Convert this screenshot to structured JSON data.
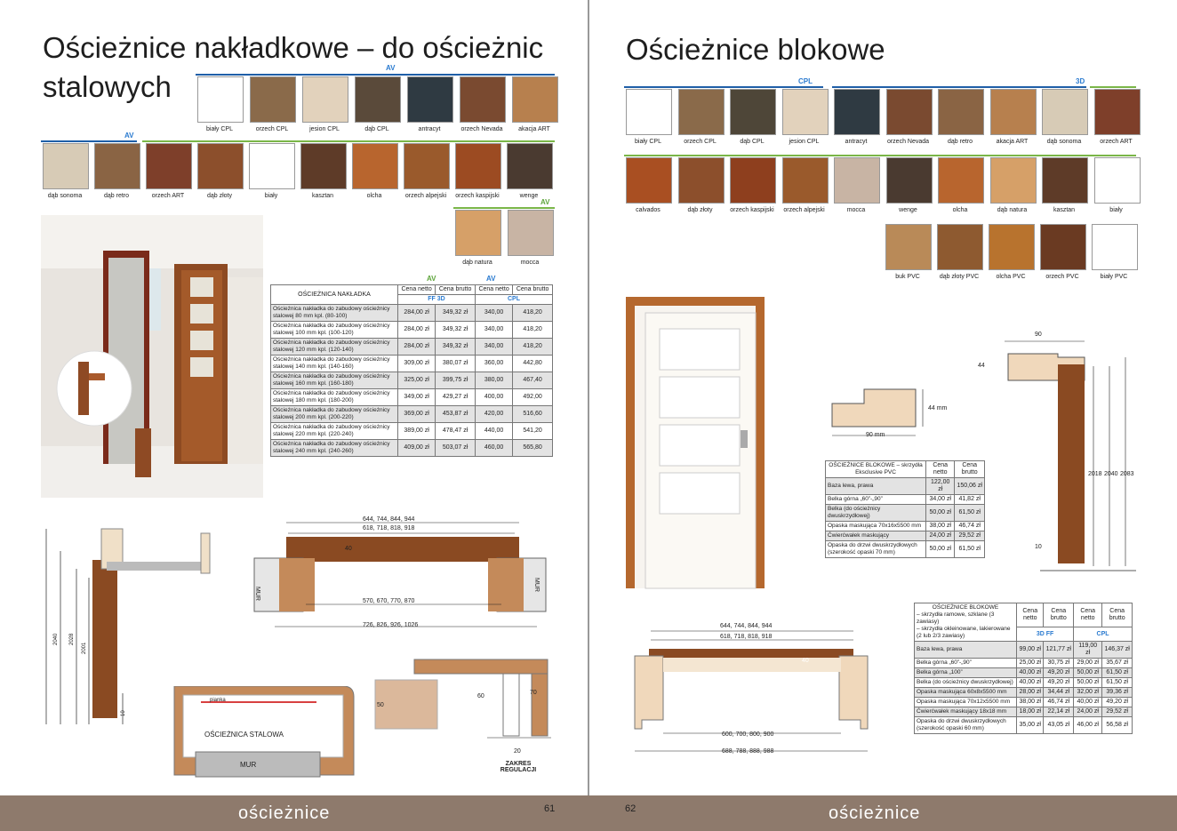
{
  "left": {
    "title_line1": "Ościeżnice nakładkowe – do ościeżnic",
    "title_line2": "stalowych",
    "swatches_row1": [
      {
        "label": "biały CPL",
        "color": "#ffffff"
      },
      {
        "label": "orzech CPL",
        "color": "#8a6a4a"
      },
      {
        "label": "jesion CPL",
        "color": "#e2d2bc"
      },
      {
        "label": "dąb CPL",
        "color": "#5a4a3a"
      },
      {
        "label": "antracyt",
        "color": "#2f3a42"
      },
      {
        "label": "orzech Nevada",
        "color": "#7a4a30"
      },
      {
        "label": "akacja ART",
        "color": "#b7804e"
      }
    ],
    "swatches_row2": [
      {
        "label": "dąb sonoma",
        "color": "#d7cbb6"
      },
      {
        "label": "dąb retro",
        "color": "#8a6444"
      },
      {
        "label": "orzech ART",
        "color": "#7e3f2a"
      },
      {
        "label": "dąb złoty",
        "color": "#8c4f2c"
      },
      {
        "label": "biały",
        "color": "#ffffff"
      },
      {
        "label": "kasztan",
        "color": "#5e3b28"
      },
      {
        "label": "olcha",
        "color": "#b8652e"
      },
      {
        "label": "orzech alpejski",
        "color": "#9a5a2c"
      },
      {
        "label": "orzech kaspijski",
        "color": "#9c4b22"
      },
      {
        "label": "wenge",
        "color": "#4a3a30"
      }
    ],
    "swatches_row3": [
      {
        "label": "dąb natura",
        "color": "#d6a068"
      },
      {
        "label": "mocca",
        "color": "#c8b4a4"
      }
    ],
    "table": {
      "header": "OŚCIEŻNICA NAKŁADKA",
      "col_netto": "Cena netto",
      "col_brutto": "Cena brutto",
      "group_a": "FF  3D",
      "group_b": "CPL",
      "rows": [
        {
          "name": "Ościeżnica nakładka do zabudowy ościeżnicy stalowej 80 mm kpl. (80-100)",
          "a_n": "284,00 zł",
          "a_b": "349,32 zł",
          "b_n": "340,00",
          "b_b": "418,20"
        },
        {
          "name": "Ościeżnica nakładka do zabudowy ościeżnicy stalowej 100 mm kpl. (100-120)",
          "a_n": "284,00 zł",
          "a_b": "349,32 zł",
          "b_n": "340,00",
          "b_b": "418,20"
        },
        {
          "name": "Ościeżnica nakładka do zabudowy ościeżnicy stalowej 120 mm kpl. (120-140)",
          "a_n": "284,00 zł",
          "a_b": "349,32 zł",
          "b_n": "340,00",
          "b_b": "418,20"
        },
        {
          "name": "Ościeżnica nakładka do zabudowy ościeżnicy stalowej 140 mm kpl. (140-160)",
          "a_n": "309,00 zł",
          "a_b": "380,07 zł",
          "b_n": "360,00",
          "b_b": "442,80"
        },
        {
          "name": "Ościeżnica nakładka do zabudowy ościeżnicy stalowej 160 mm kpl. (160-180)",
          "a_n": "325,00 zł",
          "a_b": "399,75 zł",
          "b_n": "380,00",
          "b_b": "467,40"
        },
        {
          "name": "Ościeżnica nakładka do zabudowy ościeżnicy stalowej 180 mm kpl. (180-200)",
          "a_n": "349,00 zł",
          "a_b": "429,27 zł",
          "b_n": "400,00",
          "b_b": "492,00"
        },
        {
          "name": "Ościeżnica nakładka do zabudowy ościeżnicy stalowej 200 mm kpl. (200-220)",
          "a_n": "369,00 zł",
          "a_b": "453,87 zł",
          "b_n": "420,00",
          "b_b": "516,60"
        },
        {
          "name": "Ościeżnica nakładka do zabudowy ościeżnicy stalowej 220 mm kpl. (220-240)",
          "a_n": "389,00 zł",
          "a_b": "478,47 zł",
          "b_n": "440,00",
          "b_b": "541,20"
        },
        {
          "name": "Ościeżnica nakładka do zabudowy ościeżnicy stalowej 240 mm kpl. (240-260)",
          "a_n": "409,00 zł",
          "a_b": "503,07 zł",
          "b_n": "460,00",
          "b_b": "565,80"
        }
      ]
    },
    "dims": {
      "d1": "644, 744, 844, 944",
      "d2": "618, 718, 818, 918",
      "d3": "570, 670, 770, 870",
      "d4": "726, 826, 926, 1026",
      "h1": "2079",
      "h2": "2040",
      "h3": "2028",
      "h4": "2001",
      "h5": "10",
      "v40": "40",
      "mur": "MUR",
      "osc_stal": "OŚCIEŻNICA STALOWA",
      "pianka": "pianka",
      "v50": "50",
      "v60": "60",
      "v70": "70",
      "v20": "20",
      "zakres": "ZAKRES REGULACJI"
    },
    "page_no": "61"
  },
  "right": {
    "title": "Ościeżnice blokowe",
    "swatches_row1": [
      {
        "label": "biały CPL",
        "color": "#ffffff"
      },
      {
        "label": "orzech CPL",
        "color": "#8a6a4a"
      },
      {
        "label": "dąb CPL",
        "color": "#4e4638"
      },
      {
        "label": "jesion CPL",
        "color": "#e2d2bc"
      },
      {
        "label": "antracyt",
        "color": "#2f3a42"
      },
      {
        "label": "orzech Nevada",
        "color": "#7a4a30"
      },
      {
        "label": "dąb retro",
        "color": "#8a6444"
      },
      {
        "label": "akacja ART",
        "color": "#b7804e"
      },
      {
        "label": "dąb sonoma",
        "color": "#d7cbb6"
      },
      {
        "label": "orzech ART",
        "color": "#7e3f2a"
      }
    ],
    "swatches_row2": [
      {
        "label": "calvados",
        "color": "#a94f22"
      },
      {
        "label": "dąb złoty",
        "color": "#8c4f2c"
      },
      {
        "label": "orzech kaspijski",
        "color": "#8e3f1e"
      },
      {
        "label": "orzech alpejski",
        "color": "#9a5a2c"
      },
      {
        "label": "mocca",
        "color": "#c8b4a4"
      },
      {
        "label": "wenge",
        "color": "#4a3a30"
      },
      {
        "label": "olcha",
        "color": "#b8652e"
      },
      {
        "label": "dąb natura",
        "color": "#d6a068"
      },
      {
        "label": "kasztan",
        "color": "#5e3b28"
      },
      {
        "label": "biały",
        "color": "#ffffff"
      }
    ],
    "swatches_row3": [
      {
        "label": "buk PVC",
        "color": "#b98a58"
      },
      {
        "label": "dąb złoty PVC",
        "color": "#8e5a30"
      },
      {
        "label": "olcha PVC",
        "color": "#b8732e"
      },
      {
        "label": "orzech PVC",
        "color": "#6a3a22"
      },
      {
        "label": "biały PVC",
        "color": "#ffffff"
      }
    ],
    "logo_cpl": "CPL",
    "logo_3d": "3D",
    "profile_dims": {
      "w": "90 mm",
      "h": "44 mm",
      "top": "90",
      "side": "44",
      "a": "2018",
      "b": "2040",
      "c": "2083",
      "d": "10"
    },
    "table1": {
      "header": "OŚCIEŻNICE BLOKOWE – skrzydła Eksclusive PVC",
      "col_netto": "Cena netto",
      "col_brutto": "Cena brutto",
      "rows": [
        {
          "name": "Baza lewa, prawa",
          "n": "122,00 zł",
          "b": "150,06 zł"
        },
        {
          "name": "Belka górna „60”-„90”",
          "n": "34,00 zł",
          "b": "41,82 zł"
        },
        {
          "name": "Belka (do ościeżnicy dwuskrzydłowej)",
          "n": "50,00 zł",
          "b": "61,50 zł"
        },
        {
          "name": "Opaska maskująca 70x16x5500 mm",
          "n": "38,00 zł",
          "b": "46,74 zł"
        },
        {
          "name": "Ćwierćwałek maskujący",
          "n": "24,00 zł",
          "b": "29,52 zł"
        },
        {
          "name": "Opaska do drzwi dwuskrzydłowych (szerokość opaski 70 mm)",
          "n": "50,00 zł",
          "b": "61,50 zł"
        }
      ]
    },
    "table2": {
      "header_l1": "OŚCIEŻNICE BLOKOWE",
      "header_l2": "– skrzydła ramowe, szklane (3 zawiasy)",
      "header_l3": "– skrzydła okleinowane, lakierowane (2 lub 2/3 zawiasy)",
      "col_netto": "Cena netto",
      "col_brutto": "Cena brutto",
      "group_a": "3D  FF",
      "group_b": "CPL",
      "rows": [
        {
          "name": "Baza lewa, prawa",
          "a_n": "99,00 zł",
          "a_b": "121,77 zł",
          "b_n": "119,00 zł",
          "b_b": "146,37 zł"
        },
        {
          "name": "Belka górna „60”-„90”",
          "a_n": "25,00 zł",
          "a_b": "30,75 zł",
          "b_n": "29,00 zł",
          "b_b": "35,67 zł"
        },
        {
          "name": "Belka górna „100”",
          "a_n": "40,00 zł",
          "a_b": "49,20 zł",
          "b_n": "50,00 zł",
          "b_b": "61,50 zł"
        },
        {
          "name": "Belka (do ościeżnicy dwuskrzydłowej)",
          "a_n": "40,00 zł",
          "a_b": "49,20 zł",
          "b_n": "50,00 zł",
          "b_b": "61,50 zł"
        },
        {
          "name": "Opaska maskująca 60x8x5500 mm",
          "a_n": "28,00 zł",
          "a_b": "34,44 zł",
          "b_n": "32,00 zł",
          "b_b": "39,36 zł"
        },
        {
          "name": "Opaska maskująca 70x12x5500 mm",
          "a_n": "38,00 zł",
          "a_b": "46,74 zł",
          "b_n": "40,00 zł",
          "b_b": "49,20 zł"
        },
        {
          "name": "Ćwierćwałek maskujący 18x18 mm",
          "a_n": "18,00 zł",
          "a_b": "22,14 zł",
          "b_n": "24,00 zł",
          "b_b": "29,52 zł"
        },
        {
          "name": "Opaska do drzwi dwuskrzydłowych (szerokość opaski 60 mm)",
          "a_n": "35,00 zł",
          "a_b": "43,05 zł",
          "b_n": "46,00 zł",
          "b_b": "56,58 zł"
        }
      ]
    },
    "dims": {
      "d1": "644, 744, 844, 944",
      "d2": "618, 718, 818, 918",
      "d3": "600, 700, 800, 900",
      "d4": "688, 788, 888, 988",
      "v40": "40"
    },
    "page_no": "62"
  },
  "footer_word": "ościeżnice"
}
